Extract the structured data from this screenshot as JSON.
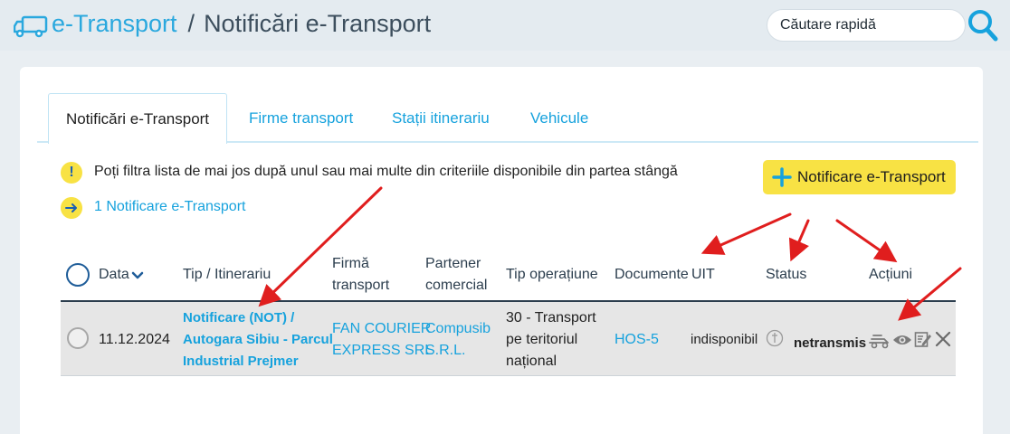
{
  "header": {
    "app_title": "e-Transport",
    "separator": "/",
    "page_title": "Notificări e-Transport",
    "search_placeholder": "Căutare rapidă"
  },
  "tabs": [
    {
      "label": "Notificări e-Transport",
      "active": true
    },
    {
      "label": "Firme transport",
      "active": false
    },
    {
      "label": "Stații itinerariu",
      "active": false
    },
    {
      "label": "Vehicule",
      "active": false
    }
  ],
  "info": {
    "filter_text": "Poți filtra lista de mai jos după unul sau mai multe din criteriile disponibile din partea stângă",
    "count_text": "1 Notificare e-Transport"
  },
  "add_button": {
    "label": "Notificare e-Transport"
  },
  "table": {
    "columns": {
      "data": "Data",
      "tip_line1": "Tip / Itinerariu",
      "firma_line1": "Firmă",
      "firma_line2": "transport",
      "partener_line1": "Partener",
      "partener_line2": "comercial",
      "tip_op": "Tip operațiune",
      "documente": "Documente",
      "uit": "UIT",
      "status": "Status",
      "actiuni": "Acțiuni"
    },
    "rows": [
      {
        "date": "11.12.2024",
        "tip_line1": "Notificare (NOT) /",
        "tip_line2": "Autogara Sibiu - Parcul",
        "tip_line3": "Industrial Prejmer",
        "firma_line1": "FAN COURIER",
        "firma_line2": "EXPRESS SRL",
        "partener_line1": "Compusib",
        "partener_line2": "S.R.L.",
        "op_line1": "30 - Transport",
        "op_line2": "pe teritoriul",
        "op_line3": "național",
        "documente": "HOS-5",
        "uit": "indisponibil",
        "status": "netransmis"
      }
    ]
  },
  "colors": {
    "accent_blue": "#16a2dd",
    "yellow": "#f8e244",
    "annotation_red": "#e01e1e",
    "dark_text": "#2c3e4e"
  },
  "icons": [
    "truck-icon",
    "search-icon",
    "info-icon",
    "arrow-right-icon",
    "plus-icon",
    "chevron-down-icon",
    "transport-icon",
    "eye-icon",
    "edit-icon",
    "close-icon",
    "timer-icon"
  ]
}
